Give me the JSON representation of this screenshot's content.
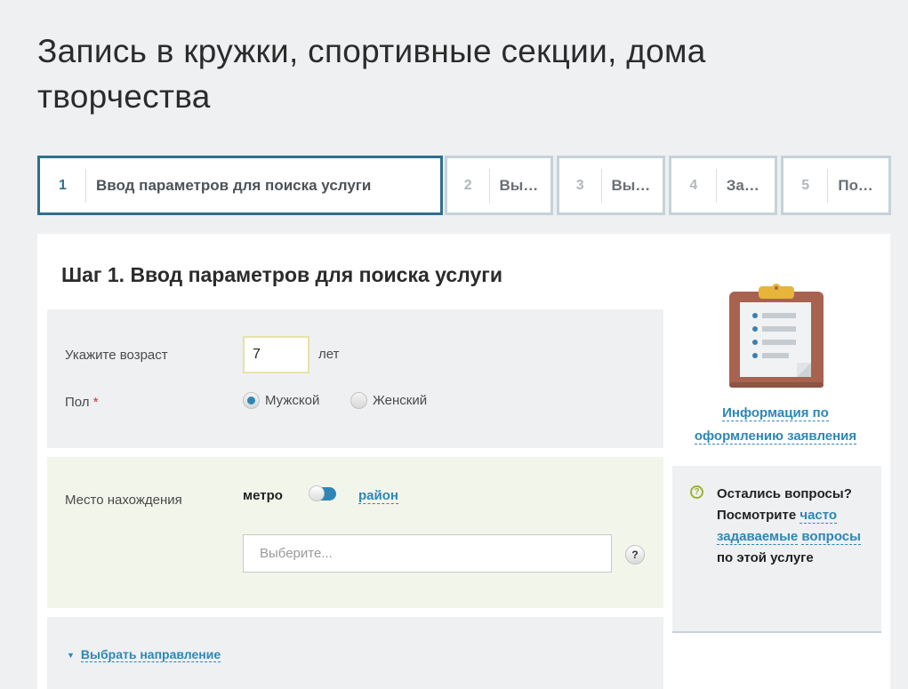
{
  "page": {
    "title": "Запись в кружки, спортивные секции, дома творчества"
  },
  "steps": [
    {
      "num": "1",
      "label": "Ввод параметров для поиска услуги",
      "active": true
    },
    {
      "num": "2",
      "label": "Выб…",
      "active": false
    },
    {
      "num": "3",
      "label": "Выб…",
      "active": false
    },
    {
      "num": "4",
      "label": "Зап…",
      "active": false
    },
    {
      "num": "5",
      "label": "Под…",
      "active": false
    }
  ],
  "form": {
    "heading": "Шаг 1. Ввод параметров для поиска услуги",
    "age": {
      "label": "Укажите возраст",
      "value": "7",
      "unit": "лет"
    },
    "gender": {
      "label": "Пол",
      "required_mark": "*",
      "options": [
        {
          "label": "Мужской",
          "checked": true
        },
        {
          "label": "Женский",
          "checked": false
        }
      ]
    },
    "location": {
      "label": "Место нахождения",
      "toggle_left": "метро",
      "toggle_right": "район",
      "select_placeholder": "Выберите...",
      "help": "?"
    },
    "direction_link": "Выбрать направление"
  },
  "sidebar": {
    "info_link_line1": "Информация по",
    "info_link_line2": "оформлению заявления",
    "faq": {
      "icon": "?",
      "text_before": "Остались вопросы? Посмотрите",
      "link1": "часто",
      "link2": "задаваемые",
      "link3": "вопросы",
      "text_after": "по этой услуге"
    }
  },
  "colors": {
    "accent": "#2d87b6",
    "active_step_border": "#2f6f8d",
    "faq_icon": "#9bb22e",
    "required": "#d0303a"
  }
}
